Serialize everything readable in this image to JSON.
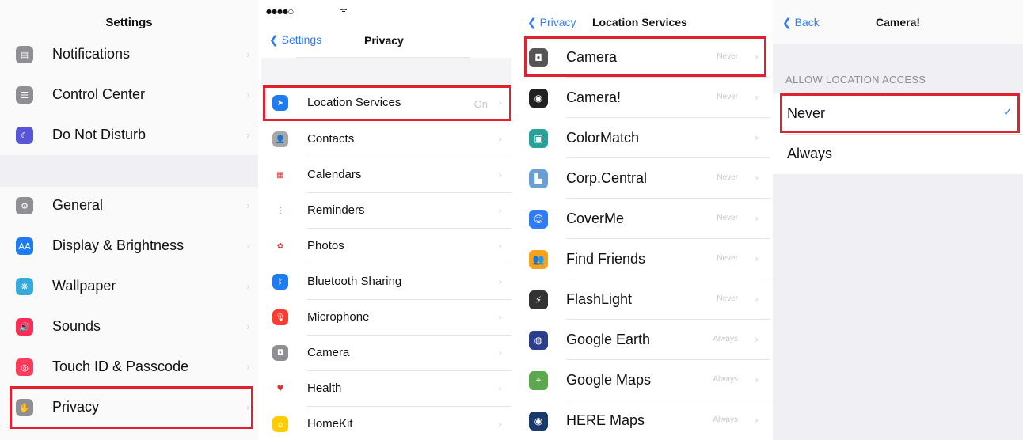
{
  "settings": {
    "title": "Settings",
    "items": [
      {
        "label": "Notifications",
        "icon": "notifications-icon",
        "color": "#8e8e93",
        "glyph": "▤"
      },
      {
        "label": "Control Center",
        "icon": "control-center-icon",
        "color": "#8e8e93",
        "glyph": "☰"
      },
      {
        "label": "Do Not Disturb",
        "icon": "moon-icon",
        "color": "#5856d6",
        "glyph": "☾"
      },
      {
        "label": "General",
        "icon": "gear-icon",
        "color": "#8e8e93",
        "glyph": "⚙"
      },
      {
        "label": "Display & Brightness",
        "icon": "display-icon",
        "color": "#1e7cf0",
        "glyph": "AA"
      },
      {
        "label": "Wallpaper",
        "icon": "wallpaper-icon",
        "color": "#35aadc",
        "glyph": "❋"
      },
      {
        "label": "Sounds",
        "icon": "sound-icon",
        "color": "#fe2d55",
        "glyph": "🔊"
      },
      {
        "label": "Touch ID & Passcode",
        "icon": "fingerprint-icon",
        "color": "#fe3b5a",
        "glyph": "◎"
      },
      {
        "label": "Privacy",
        "icon": "hand-icon",
        "color": "#8e8e93",
        "glyph": "✋"
      }
    ]
  },
  "privacy": {
    "status_signal": "●●●●○",
    "status_wifi": "ᯤ",
    "back_label": "Settings",
    "title": "Privacy",
    "items": [
      {
        "label": "Location Services",
        "value": "On",
        "icon": "location-arrow-icon",
        "color": "#1e7cf0",
        "glyph": "➤"
      },
      {
        "label": "Contacts",
        "value": "",
        "icon": "contacts-icon",
        "color": "#a7a7a7",
        "glyph": "👤"
      },
      {
        "label": "Calendars",
        "value": "",
        "icon": "calendar-icon",
        "color": "#ffffff",
        "glyph": "▦"
      },
      {
        "label": "Reminders",
        "value": "",
        "icon": "reminders-icon",
        "color": "#ffffff",
        "glyph": "⋮"
      },
      {
        "label": "Photos",
        "value": "",
        "icon": "photos-icon",
        "color": "#ffffff",
        "glyph": "✿"
      },
      {
        "label": "Bluetooth Sharing",
        "value": "",
        "icon": "bluetooth-icon",
        "color": "#1e7cf0",
        "glyph": "ᛒ"
      },
      {
        "label": "Microphone",
        "value": "",
        "icon": "microphone-icon",
        "color": "#fe3b30",
        "glyph": "🎙"
      },
      {
        "label": "Camera",
        "value": "",
        "icon": "camera-icon",
        "color": "#8e8e93",
        "glyph": "◘"
      },
      {
        "label": "Health",
        "value": "",
        "icon": "heart-icon",
        "color": "#ffffff",
        "glyph": "♥"
      },
      {
        "label": "HomeKit",
        "value": "",
        "icon": "home-icon",
        "color": "#ffcc00",
        "glyph": "⌂"
      }
    ]
  },
  "location": {
    "back_label": "Privacy",
    "title": "Location Services",
    "items": [
      {
        "label": "Camera",
        "value": "Never",
        "icon": "camera-app-icon",
        "color": "#555555",
        "glyph": "◘"
      },
      {
        "label": "Camera!",
        "value": "Never",
        "icon": "camera-lens-icon",
        "color": "#222222",
        "glyph": "◉"
      },
      {
        "label": "ColorMatch",
        "value": "",
        "icon": "colormatch-icon",
        "color": "#2aa198",
        "glyph": "▣"
      },
      {
        "label": "Corp.Central",
        "value": "Never",
        "icon": "corp-central-icon",
        "color": "#6a9fd4",
        "glyph": "▙"
      },
      {
        "label": "CoverMe",
        "value": "Never",
        "icon": "coverme-icon",
        "color": "#2f7cf6",
        "glyph": "☺"
      },
      {
        "label": "Find Friends",
        "value": "Never",
        "icon": "find-friends-icon",
        "color": "#f7a21b",
        "glyph": "👥"
      },
      {
        "label": "FlashLight",
        "value": "Never",
        "icon": "flashlight-icon",
        "color": "#333333",
        "glyph": "⚡"
      },
      {
        "label": "Google Earth",
        "value": "Always",
        "icon": "google-earth-icon",
        "color": "#2b3e8c",
        "glyph": "◍"
      },
      {
        "label": "Google Maps",
        "value": "Always",
        "icon": "google-maps-icon",
        "color": "#5ba84f",
        "glyph": "⌖"
      },
      {
        "label": "HERE Maps",
        "value": "Always",
        "icon": "here-maps-icon",
        "color": "#1a3a6b",
        "glyph": "◉"
      }
    ]
  },
  "camera_detail": {
    "back_label": "Back",
    "title": "Camera!",
    "section_header": "ALLOW LOCATION ACCESS",
    "options": [
      {
        "label": "Never",
        "selected": true
      },
      {
        "label": "Always",
        "selected": false
      }
    ],
    "checkmark": "✓"
  },
  "colors": {
    "accent": "#2f7cf6",
    "highlight": "#e0212f"
  }
}
